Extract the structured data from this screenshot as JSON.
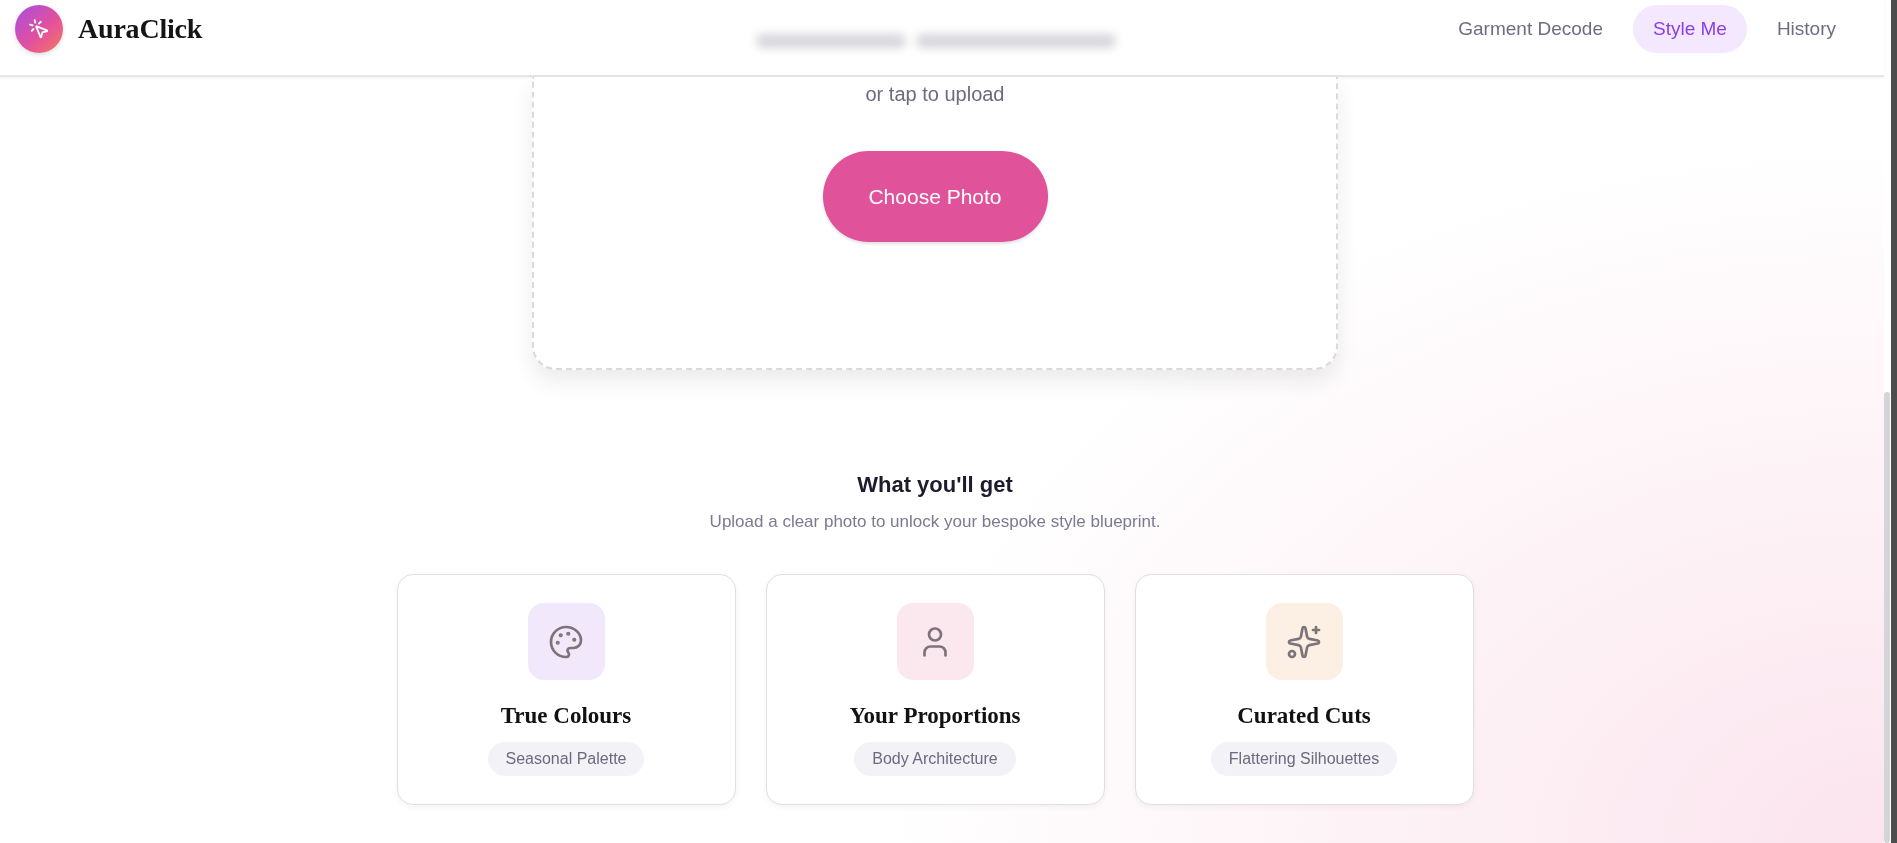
{
  "header": {
    "brand": "AuraClick",
    "nav": [
      {
        "label": "Garment Decode",
        "selected": false
      },
      {
        "label": "Style Me",
        "selected": true
      },
      {
        "label": "History",
        "selected": false
      }
    ]
  },
  "upload": {
    "hint": "or tap to upload",
    "button": "Choose Photo"
  },
  "features": {
    "title": "What you'll get",
    "subtitle": "Upload a clear photo to unlock your bespoke style blueprint.",
    "items": [
      {
        "title": "True Colours",
        "tag": "Seasonal Palette",
        "color": "#f1e8fc"
      },
      {
        "title": "Your Proportions",
        "tag": "Body Architecture",
        "color": "#fbe8ef"
      },
      {
        "title": "Curated Cuts",
        "tag": "Flattering Silhouettes",
        "color": "#fcefe4"
      }
    ]
  }
}
